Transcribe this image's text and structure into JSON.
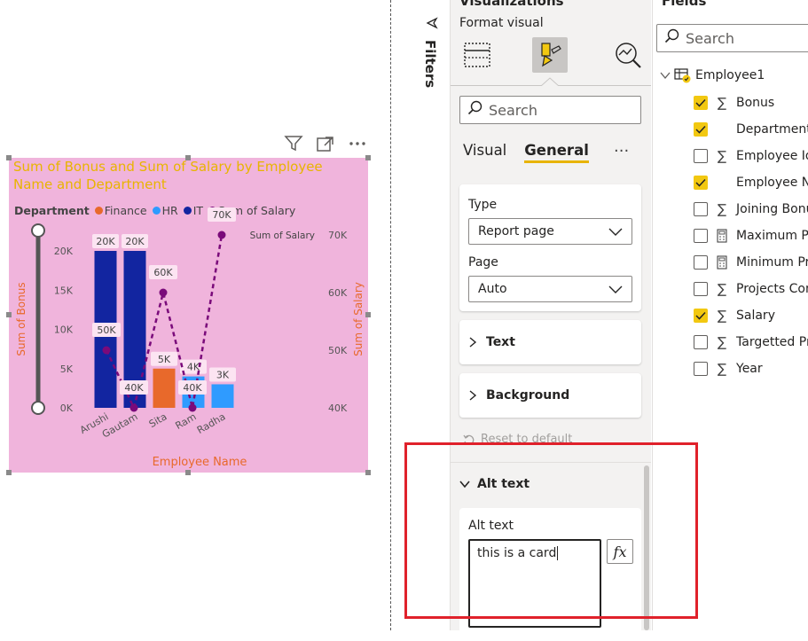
{
  "visual": {
    "title": "Sum of Bonus and Sum of Salary by Employee Name and Department",
    "legend_title": "Department",
    "legend_items": [
      {
        "label": "Finance",
        "color": "#e8692b"
      },
      {
        "label": "HR",
        "color": "#2f9bff"
      },
      {
        "label": "IT",
        "color": "#1225a0"
      },
      {
        "label": "Sum of Salary",
        "color": "#7a0a7a"
      }
    ]
  },
  "chart_data": {
    "type": "bar",
    "title": "Sum of Bonus and Sum of Salary by Employee Name and Department",
    "xlabel": "Employee Name",
    "ylabel": "Sum of Bonus",
    "y2label": "Sum of Salary",
    "y2_series_label": "Sum of Salary",
    "categories": [
      "Arushi",
      "Gautam",
      "Sita",
      "Ram",
      "Radha"
    ],
    "ylim": [
      0,
      20000
    ],
    "y_ticks": [
      "0K",
      "5K",
      "10K",
      "15K",
      "20K"
    ],
    "y2lim": [
      40000,
      70000
    ],
    "y2_ticks": [
      "40K",
      "50K",
      "60K",
      "70K"
    ],
    "bars": [
      {
        "category": "Arushi",
        "department": "IT",
        "value": 20000,
        "label": "20K"
      },
      {
        "category": "Gautam",
        "department": "IT",
        "value": 20000,
        "label": "20K"
      },
      {
        "category": "Sita",
        "department": "Finance",
        "value": 5000,
        "label": "5K"
      },
      {
        "category": "Ram",
        "department": "HR",
        "value": 4000,
        "label": "4K"
      },
      {
        "category": "Radha",
        "department": "HR",
        "value": 3000,
        "label": "3K"
      }
    ],
    "line": {
      "name": "Sum of Salary",
      "points": [
        {
          "category": "Arushi",
          "value": 50000,
          "label": "50K"
        },
        {
          "category": "Gautam",
          "value": 40000,
          "label": "40K"
        },
        {
          "category": "Sita",
          "value": 60000,
          "label": "60K"
        },
        {
          "category": "Ram",
          "value": 40000,
          "label": "40K"
        },
        {
          "category": "Radha",
          "value": 70000,
          "label": "70K"
        }
      ]
    },
    "legend": "top-left",
    "grid": false
  },
  "filters": {
    "label": "Filters"
  },
  "viz_pane": {
    "header": "Visualizations",
    "format_visual": "Format visual",
    "search_placeholder": "Search",
    "tabs": [
      "Visual",
      "General"
    ],
    "active_tab": "General",
    "type_label": "Type",
    "type_value": "Report page",
    "page_label": "Page",
    "page_value": "Auto",
    "sections": [
      "Text",
      "Background"
    ],
    "reset": "Reset to default",
    "alt_text_header": "Alt text",
    "alt_text_label": "Alt text",
    "alt_text_value": "this is a card",
    "fx": "fx"
  },
  "fields_pane": {
    "header": "Fields",
    "search_placeholder": "Search",
    "table": "Employee1",
    "fields": [
      {
        "name": "Bonus",
        "checked": true,
        "sigma": true
      },
      {
        "name": "Department",
        "checked": true,
        "sigma": false
      },
      {
        "name": "Employee Id",
        "checked": false,
        "sigma": true
      },
      {
        "name": "Employee Na",
        "checked": true,
        "sigma": false
      },
      {
        "name": "Joining Bonu",
        "checked": false,
        "sigma": true
      },
      {
        "name": "Maximum Pr",
        "checked": false,
        "calc": true
      },
      {
        "name": "Minimum Pr",
        "checked": false,
        "calc": true
      },
      {
        "name": "Projects Com",
        "checked": false,
        "sigma": true
      },
      {
        "name": "Salary",
        "checked": true,
        "sigma": true
      },
      {
        "name": "Targetted Pr",
        "checked": false,
        "sigma": true
      },
      {
        "name": "Year",
        "checked": false,
        "sigma": true
      }
    ]
  }
}
